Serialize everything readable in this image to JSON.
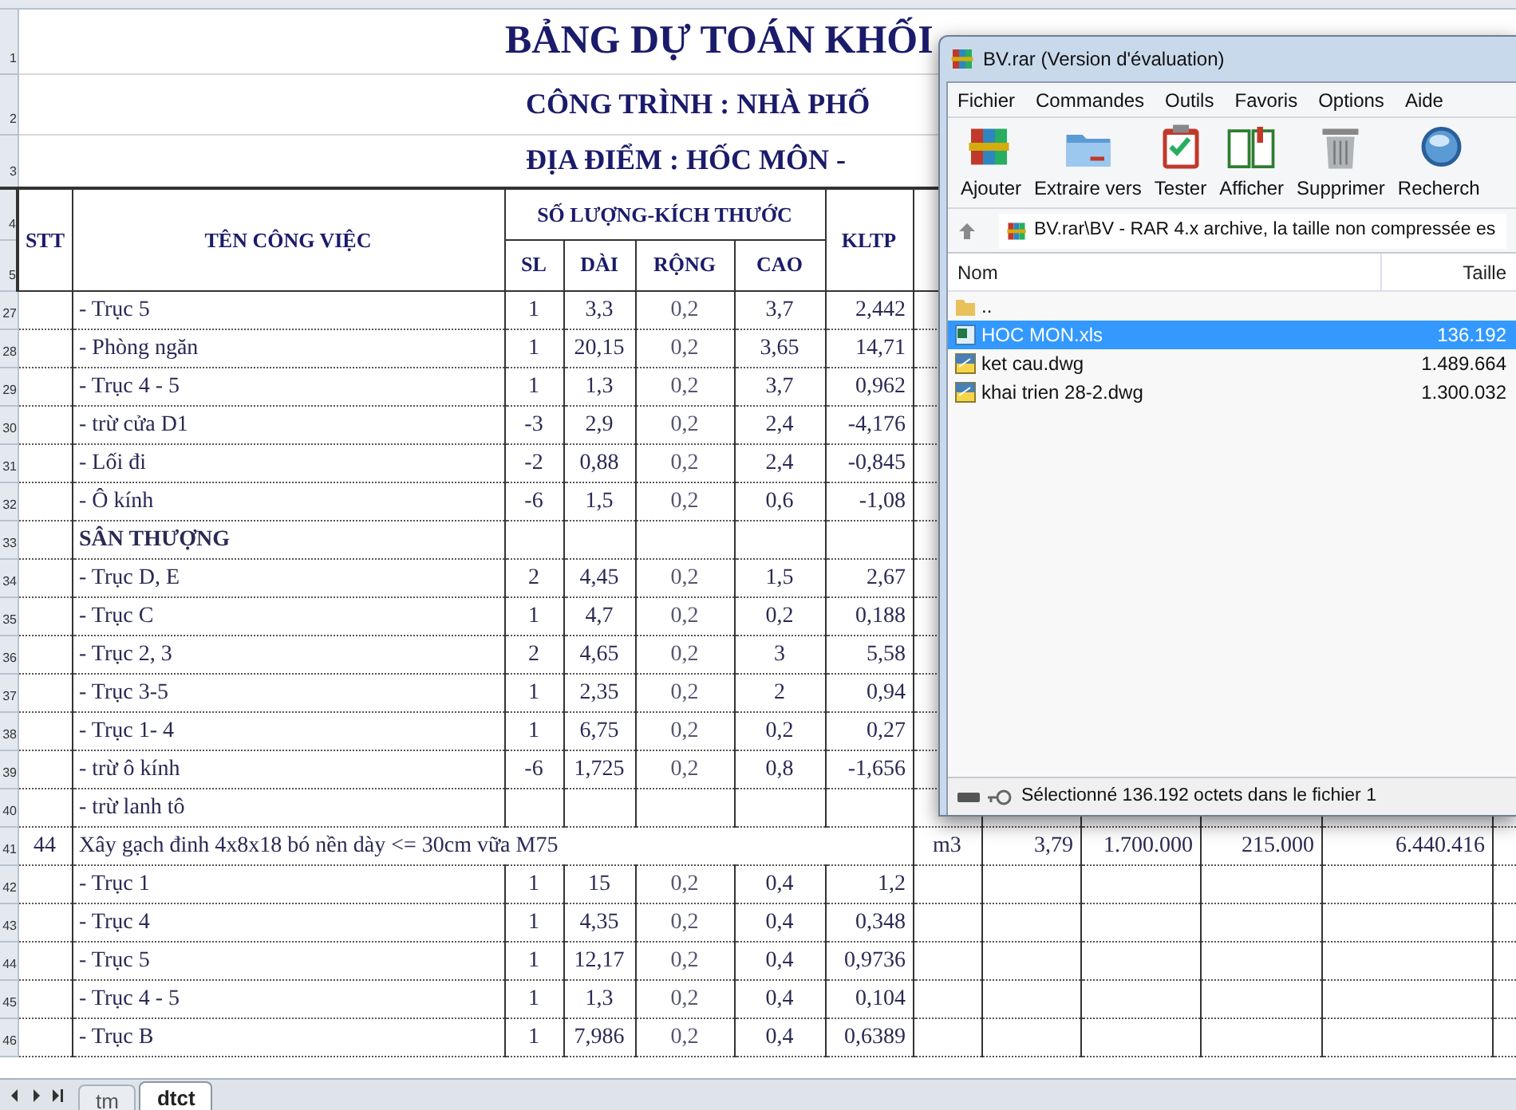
{
  "sheet": {
    "title": "BẢNG DỰ TOÁN KHỐI",
    "project": "CÔNG TRÌNH : NHÀ PHỐ",
    "location": "ĐỊA ĐIỂM : HỐC MÔN -",
    "title_row_numbers": [
      "1",
      "2",
      "3"
    ],
    "header": {
      "row_numbers": [
        "4",
        "5"
      ],
      "stt": "STT",
      "name": "TÊN CÔNG VIỆC",
      "group": "SỐ LƯỢNG-KÍCH THƯỚC",
      "sl": "SL",
      "dai": "DÀI",
      "rong": "RỘNG",
      "cao": "CAO",
      "kltp": "KLTP"
    },
    "rows": [
      {
        "row": "27",
        "kind": "item",
        "name": "- Trục 5",
        "sl": "1",
        "dai": "3,3",
        "rong": "0,2",
        "cao": "3,7",
        "kltp": "2,442"
      },
      {
        "row": "28",
        "kind": "item",
        "name": "- Phòng ngăn",
        "sl": "1",
        "dai": "20,15",
        "rong": "0,2",
        "cao": "3,65",
        "kltp": "14,71"
      },
      {
        "row": "29",
        "kind": "item",
        "name": "- Trục 4 - 5",
        "sl": "1",
        "dai": "1,3",
        "rong": "0,2",
        "cao": "3,7",
        "kltp": "0,962"
      },
      {
        "row": "30",
        "kind": "item",
        "name": "- trừ cửa D1",
        "sl": "-3",
        "dai": "2,9",
        "rong": "0,2",
        "cao": "2,4",
        "kltp": "-4,176"
      },
      {
        "row": "31",
        "kind": "item",
        "name": "- Lối đi",
        "sl": "-2",
        "dai": "0,88",
        "rong": "0,2",
        "cao": "2,4",
        "kltp": "-0,845"
      },
      {
        "row": "32",
        "kind": "item",
        "name": "- Ô kính",
        "sl": "-6",
        "dai": "1,5",
        "rong": "0,2",
        "cao": "0,6",
        "kltp": "-1,08"
      },
      {
        "row": "33",
        "kind": "section",
        "name": "SÂN THƯỢNG"
      },
      {
        "row": "34",
        "kind": "item",
        "name": "- Trục D, E",
        "sl": "2",
        "dai": "4,45",
        "rong": "0,2",
        "cao": "1,5",
        "kltp": "2,67"
      },
      {
        "row": "35",
        "kind": "item",
        "name": "- Trục C",
        "sl": "1",
        "dai": "4,7",
        "rong": "0,2",
        "cao": "0,2",
        "kltp": "0,188"
      },
      {
        "row": "36",
        "kind": "item",
        "name": "- Trục 2, 3",
        "sl": "2",
        "dai": "4,65",
        "rong": "0,2",
        "cao": "3",
        "kltp": "5,58"
      },
      {
        "row": "37",
        "kind": "item",
        "name": "- Trục 3-5",
        "sl": "1",
        "dai": "2,35",
        "rong": "0,2",
        "cao": "2",
        "kltp": "0,94"
      },
      {
        "row": "38",
        "kind": "item",
        "name": "- Trục 1- 4",
        "sl": "1",
        "dai": "6,75",
        "rong": "0,2",
        "cao": "0,2",
        "kltp": "0,27"
      },
      {
        "row": "39",
        "kind": "item",
        "name": "- trừ ô kính",
        "sl": "-6",
        "dai": "1,725",
        "rong": "0,2",
        "cao": "0,8",
        "kltp": "-1,656"
      },
      {
        "row": "40",
        "kind": "item",
        "name": "- trừ lanh tô"
      },
      {
        "row": "41",
        "kind": "task",
        "stt": "44",
        "name": "Xây gạch đinh 4x8x18 bó nền dày <= 30cm vữa M75",
        "column_8": "m3",
        "column_9": "3,79",
        "column_10": "1.700.000",
        "column_11": "215.000",
        "column_12": "6.440.416"
      },
      {
        "row": "42",
        "kind": "item",
        "name": "- Trục 1",
        "sl": "1",
        "dai": "15",
        "rong": "0,2",
        "cao": "0,4",
        "kltp": "1,2"
      },
      {
        "row": "43",
        "kind": "item",
        "name": "- Trục 4",
        "sl": "1",
        "dai": "4,35",
        "rong": "0,2",
        "cao": "0,4",
        "kltp": "0,348"
      },
      {
        "row": "44",
        "kind": "item",
        "name": "- Trục 5",
        "sl": "1",
        "dai": "12,17",
        "rong": "0,2",
        "cao": "0,4",
        "kltp": "0,9736"
      },
      {
        "row": "45",
        "kind": "item",
        "name": "- Trục 4 - 5",
        "sl": "1",
        "dai": "1,3",
        "rong": "0,2",
        "cao": "0,4",
        "kltp": "0,104"
      },
      {
        "row": "46",
        "kind": "item",
        "name": "- Trục B",
        "sl": "1",
        "dai": "7,986",
        "rong": "0,2",
        "cao": "0,4",
        "kltp": "0,6389"
      }
    ],
    "tabs": [
      {
        "label": "tm",
        "selected": false
      },
      {
        "label": "dtct",
        "selected": true
      }
    ]
  },
  "archive_window": {
    "title": "BV.rar (Version d'évaluation)",
    "menu": [
      "Fichier",
      "Commandes",
      "Outils",
      "Favoris",
      "Options",
      "Aide"
    ],
    "toolbar": [
      "Ajouter",
      "Extraire vers",
      "Tester",
      "Afficher",
      "Supprimer",
      "Recherch"
    ],
    "path": "BV.rar\\BV - RAR 4.x archive, la taille non compressée es",
    "columns": [
      "Nom",
      "Taille"
    ],
    "files": [
      {
        "kind": "parent",
        "name": "..",
        "selected": false
      },
      {
        "kind": "spreadsheet",
        "name": "HOC MON.xls",
        "size": "136.192",
        "selected": true
      },
      {
        "kind": "drawing",
        "name": "ket cau.dwg",
        "size": "1.489.664",
        "selected": false
      },
      {
        "kind": "drawing",
        "name": "khai trien 28-2.dwg",
        "size": "1.300.032",
        "selected": false
      }
    ],
    "status": "Sélectionné 136.192 octets dans le fichier 1"
  }
}
